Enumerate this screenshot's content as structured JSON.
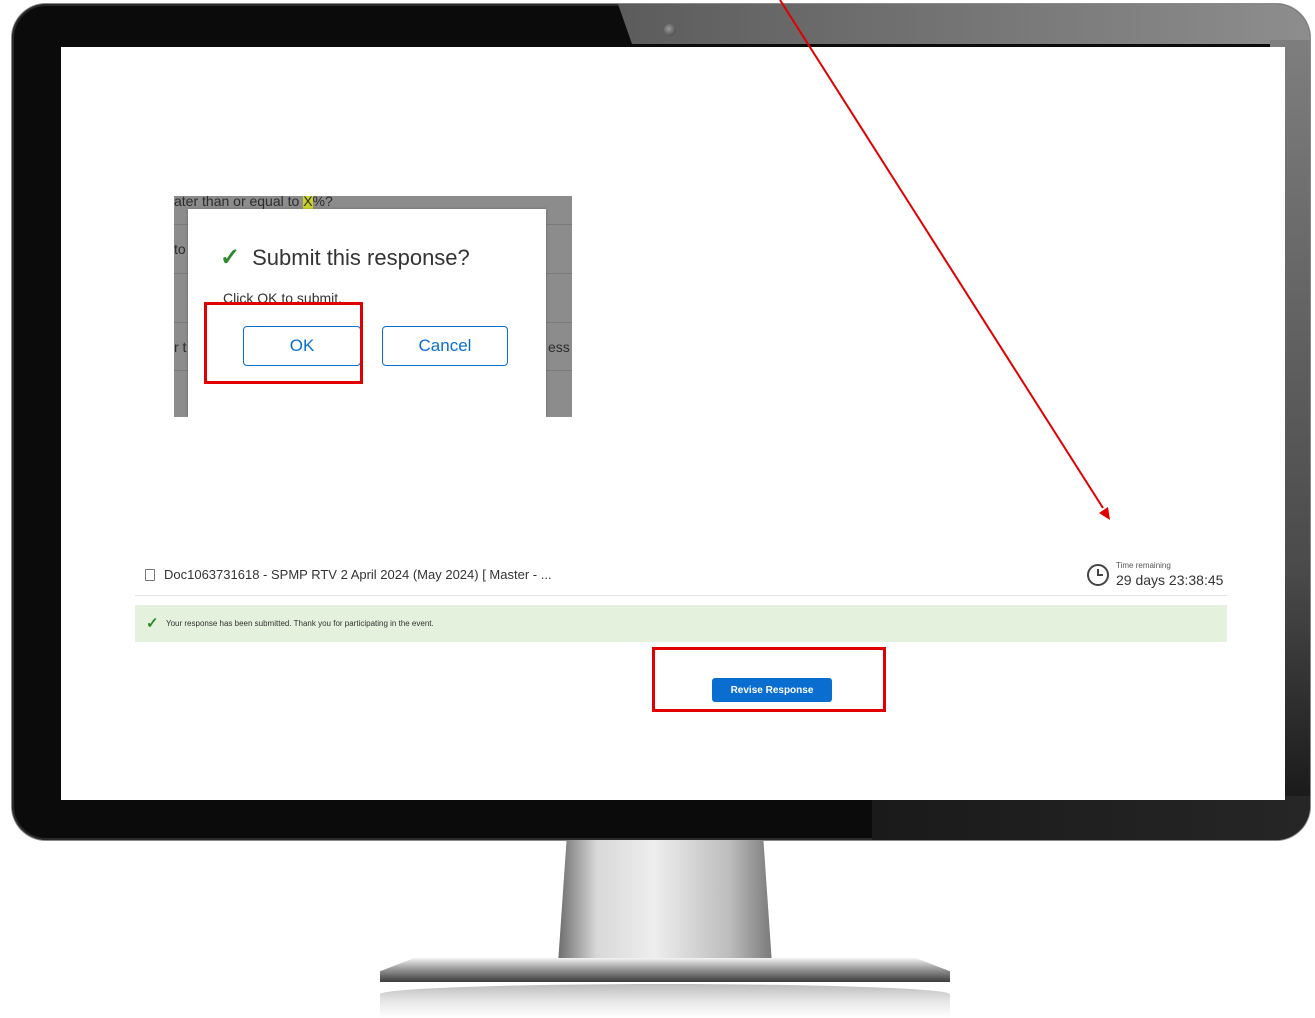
{
  "dialog_shot": {
    "background_lines": [
      {
        "text_before": "ater than or equal to ",
        "highlight": "X",
        "text_after": "%?"
      },
      {
        "text": "to"
      },
      {
        "text": "r t"
      },
      {
        "text": "ess"
      }
    ],
    "dialog": {
      "title": "Submit this response?",
      "message": "Click OK to submit.",
      "ok_label": "OK",
      "cancel_label": "Cancel"
    }
  },
  "event": {
    "doc_title": "Doc1063731618 - SPMP RTV 2 April 2024 (May 2024) [ Master - ...",
    "time_remaining_label": "Time remaining",
    "time_remaining_value": "29 days 23:38:45",
    "success_message": "Your response has been submitted. Thank you for participating in the event.",
    "revise_label": "Revise Response"
  },
  "colors": {
    "accent": "#0a6ed1",
    "success_bg": "#e3f1dd",
    "check": "#2f8a2f",
    "annotation": "#e00000"
  }
}
